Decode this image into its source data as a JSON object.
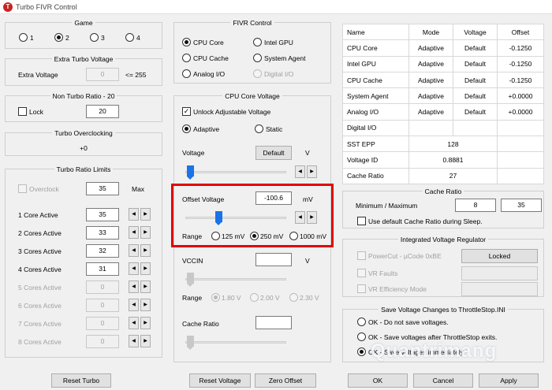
{
  "window": {
    "title": "Turbo FIVR Control",
    "icon": "T"
  },
  "game": {
    "title": "Game",
    "options": [
      "1",
      "2",
      "3",
      "4"
    ],
    "selected": "2"
  },
  "extra_turbo": {
    "title": "Extra Turbo Voltage",
    "label": "Extra Voltage",
    "value": "0",
    "limit": "<= 255"
  },
  "non_turbo": {
    "title": "Non Turbo Ratio - 20",
    "lock_label": "Lock",
    "value": "20"
  },
  "turbo_oc": {
    "title": "Turbo Overclocking",
    "value": "+0"
  },
  "turbo_ratio": {
    "title": "Turbo Ratio Limits",
    "overclock_label": "Overclock",
    "overclock_value": "35",
    "max_label": "Max",
    "rows": [
      {
        "label": "1 Core Active",
        "value": "35"
      },
      {
        "label": "2 Cores Active",
        "value": "33"
      },
      {
        "label": "3 Cores Active",
        "value": "32"
      },
      {
        "label": "4 Cores Active",
        "value": "31"
      },
      {
        "label": "5 Cores Active",
        "value": "0"
      },
      {
        "label": "6 Cores Active",
        "value": "0"
      },
      {
        "label": "7 Cores Active",
        "value": "0"
      },
      {
        "label": "8 Cores Active",
        "value": "0"
      }
    ]
  },
  "fivr": {
    "title": "FIVR Control",
    "options": [
      "CPU Core",
      "Intel GPU",
      "CPU Cache",
      "System Agent",
      "Analog I/O",
      "Digital I/O"
    ],
    "selected": "CPU Core"
  },
  "core_voltage": {
    "title": "CPU Core Voltage",
    "unlock_label": "Unlock Adjustable Voltage",
    "mode_adaptive": "Adaptive",
    "mode_static": "Static",
    "voltage_label": "Voltage",
    "voltage_value": "Default",
    "voltage_unit": "V",
    "offset_label": "Offset Voltage",
    "offset_value": "-100.6",
    "offset_unit": "mV",
    "range_label": "Range",
    "range_options": [
      "125 mV",
      "250 mV",
      "1000 mV"
    ],
    "range_selected": "250 mV",
    "vccin_label": "VCCIN",
    "vccin_unit": "V",
    "vccin_range_label": "Range",
    "vccin_range_options": [
      "1.80 V",
      "2.00 V",
      "2.30 V"
    ],
    "cache_ratio_label": "Cache Ratio"
  },
  "table": {
    "headers": [
      "Name",
      "Mode",
      "Voltage",
      "Offset"
    ],
    "rows": [
      [
        "CPU Core",
        "Adaptive",
        "Default",
        "-0.1250"
      ],
      [
        "Intel GPU",
        "Adaptive",
        "Default",
        "-0.1250"
      ],
      [
        "CPU Cache",
        "Adaptive",
        "Default",
        "-0.1250"
      ],
      [
        "System Agent",
        "Adaptive",
        "Default",
        "+0.0000"
      ],
      [
        "Analog I/O",
        "Adaptive",
        "Default",
        "+0.0000"
      ],
      [
        "Digital I/O",
        "",
        "",
        ""
      ]
    ],
    "extra": [
      {
        "label": "SST EPP",
        "value": "128"
      },
      {
        "label": "Voltage ID",
        "value": "0.8881"
      },
      {
        "label": "Cache Ratio",
        "value": "27"
      }
    ]
  },
  "cache_ratio": {
    "title": "Cache Ratio",
    "label": "Minimum / Maximum",
    "min": "8",
    "max": "35",
    "default_label": "Use default Cache Ratio during Sleep."
  },
  "ivr": {
    "title": "Integrated Voltage Regulator",
    "powercut_label": "PowerCut  -  µCode 0xBE",
    "powercut_button": "Locked",
    "vr_faults_label": "VR Faults",
    "vr_efficiency_label": "VR Efficiency Mode"
  },
  "save": {
    "title": "Save Voltage Changes to ThrottleStop.INI",
    "options": [
      "OK - Do not save voltages.",
      "OK - Save voltages after ThrottleStop exits.",
      "OK - Save voltages immediately."
    ],
    "selected": 2
  },
  "buttons": {
    "reset_turbo": "Reset Turbo",
    "reset_voltage": "Reset Voltage",
    "zero_offset": "Zero Offset",
    "ok": "OK",
    "cancel": "Cancel",
    "apply": "Apply"
  },
  "watermark": "Quantrimang",
  "colors": {
    "highlight": "#e40000",
    "slider": "#1a73e8",
    "app_icon": "#c72323"
  }
}
